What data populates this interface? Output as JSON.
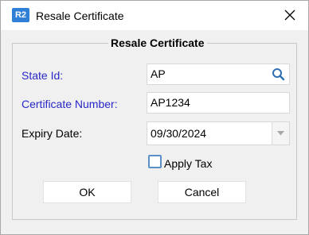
{
  "titlebar": {
    "app_icon_text": "R2",
    "title": "Resale Certificate",
    "close_icon": "close-icon"
  },
  "group": {
    "legend": "Resale Certificate"
  },
  "form": {
    "state_id": {
      "label": "State Id:",
      "value": "AP",
      "icon": "search-icon"
    },
    "certificate_number": {
      "label": "Certificate Number:",
      "value": "AP1234"
    },
    "expiry_date": {
      "label": "Expiry Date:",
      "value": "09/30/2024",
      "icon": "chevron-down-icon"
    },
    "apply_tax": {
      "label": "Apply Tax",
      "checked": false
    }
  },
  "buttons": {
    "ok": "OK",
    "cancel": "Cancel"
  },
  "colors": {
    "required_label": "#2828c8",
    "app_icon_bg": "#2f7fd6",
    "search_icon": "#2f6fb4"
  }
}
